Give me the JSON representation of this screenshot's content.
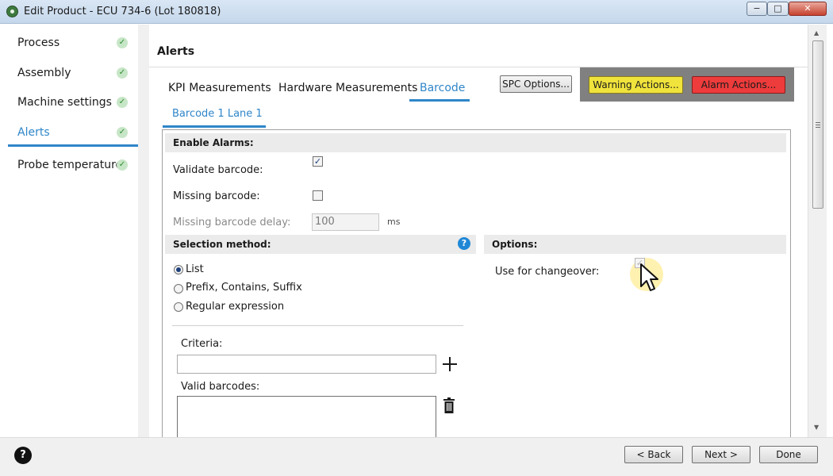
{
  "window": {
    "title": "Edit Product - ECU 734-6 (Lot 180818)",
    "minimize_glyph": "−",
    "maximize_glyph": "□",
    "close_glyph": "✕"
  },
  "sidebar": {
    "items": [
      {
        "label": "Process",
        "complete": true,
        "active": false
      },
      {
        "label": "Assembly",
        "complete": true,
        "active": false
      },
      {
        "label": "Machine settings",
        "complete": true,
        "active": false
      },
      {
        "label": "Alerts",
        "complete": true,
        "active": true
      },
      {
        "label": "Probe temperature",
        "complete": true,
        "active": false
      }
    ],
    "check_glyph": "✓",
    "accent_color": "#2f86c9",
    "check_color": "#2e8b2e"
  },
  "main": {
    "title": "Alerts",
    "tabs": [
      {
        "label": "KPI Measurements",
        "active": false
      },
      {
        "label": "Hardware Measurements",
        "active": false
      },
      {
        "label": "Barcode",
        "active": true
      }
    ],
    "spc_button": "SPC Options...",
    "warning_button": "Warning Actions...",
    "alarm_button": "Alarm Actions...",
    "warning_color": "#f0e33c",
    "alarm_color": "#ee3b3b",
    "subtab": "Barcode 1 Lane 1"
  },
  "enable_alarms": {
    "heading": "Enable Alarms:",
    "validate_barcode": {
      "label": "Validate barcode:",
      "checked": true
    },
    "missing_barcode": {
      "label": "Missing barcode:",
      "checked": false
    },
    "missing_barcode_delay": {
      "label": "Missing barcode delay:",
      "value": "100",
      "unit": "ms",
      "enabled": false
    }
  },
  "selection_method": {
    "heading": "Selection method:",
    "help_glyph": "?",
    "options": [
      {
        "label": "List",
        "selected": true
      },
      {
        "label": "Prefix, Contains, Suffix",
        "selected": false
      },
      {
        "label": "Regular expression",
        "selected": false
      }
    ],
    "criteria_label": "Criteria:",
    "criteria_value": "",
    "valid_barcodes_label": "Valid barcodes:"
  },
  "options": {
    "heading": "Options:",
    "use_for_changeover": {
      "label": "Use for changeover:",
      "checked": true,
      "enabled": false
    }
  },
  "footer": {
    "help_glyph": "?",
    "back": "< Back",
    "next": "Next >",
    "done": "Done"
  },
  "checkbox_glyph": "✓",
  "scrollbar": {
    "up_glyph": "▲",
    "down_glyph": "▼"
  }
}
